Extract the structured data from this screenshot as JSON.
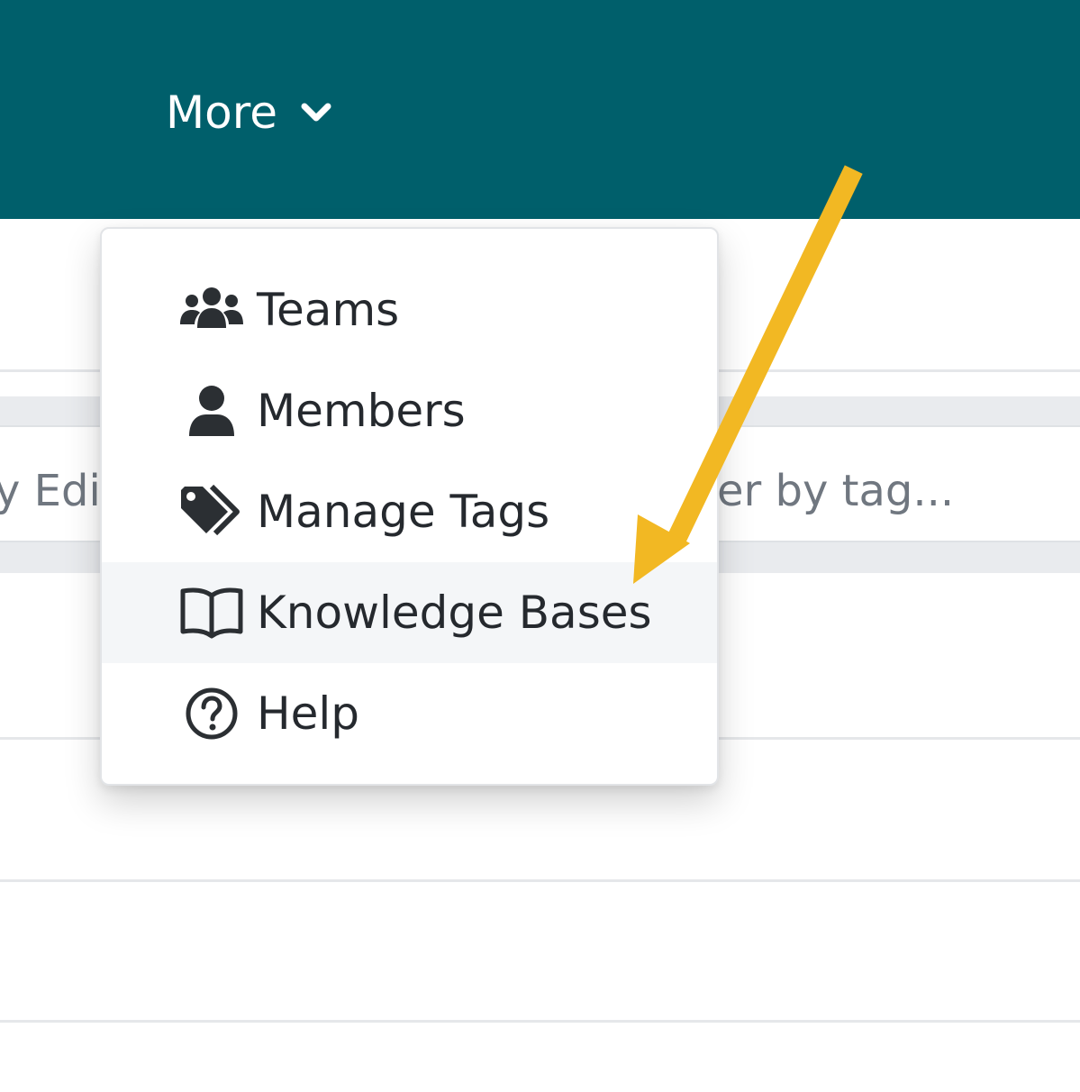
{
  "nav": {
    "more_label": "More"
  },
  "background": {
    "left_fragment": "y Edi",
    "tag_filter_fragment": "er by tag..."
  },
  "menu": {
    "items": [
      {
        "label": "Teams",
        "icon": "users-icon"
      },
      {
        "label": "Members",
        "icon": "user-icon"
      },
      {
        "label": "Manage Tags",
        "icon": "tags-icon"
      },
      {
        "label": "Knowledge Bases",
        "icon": "book-open-icon",
        "highlighted": true
      },
      {
        "label": "Help",
        "icon": "question-circle-icon"
      }
    ]
  },
  "colors": {
    "topbar": "#005f6b",
    "arrow": "#f2b823"
  }
}
